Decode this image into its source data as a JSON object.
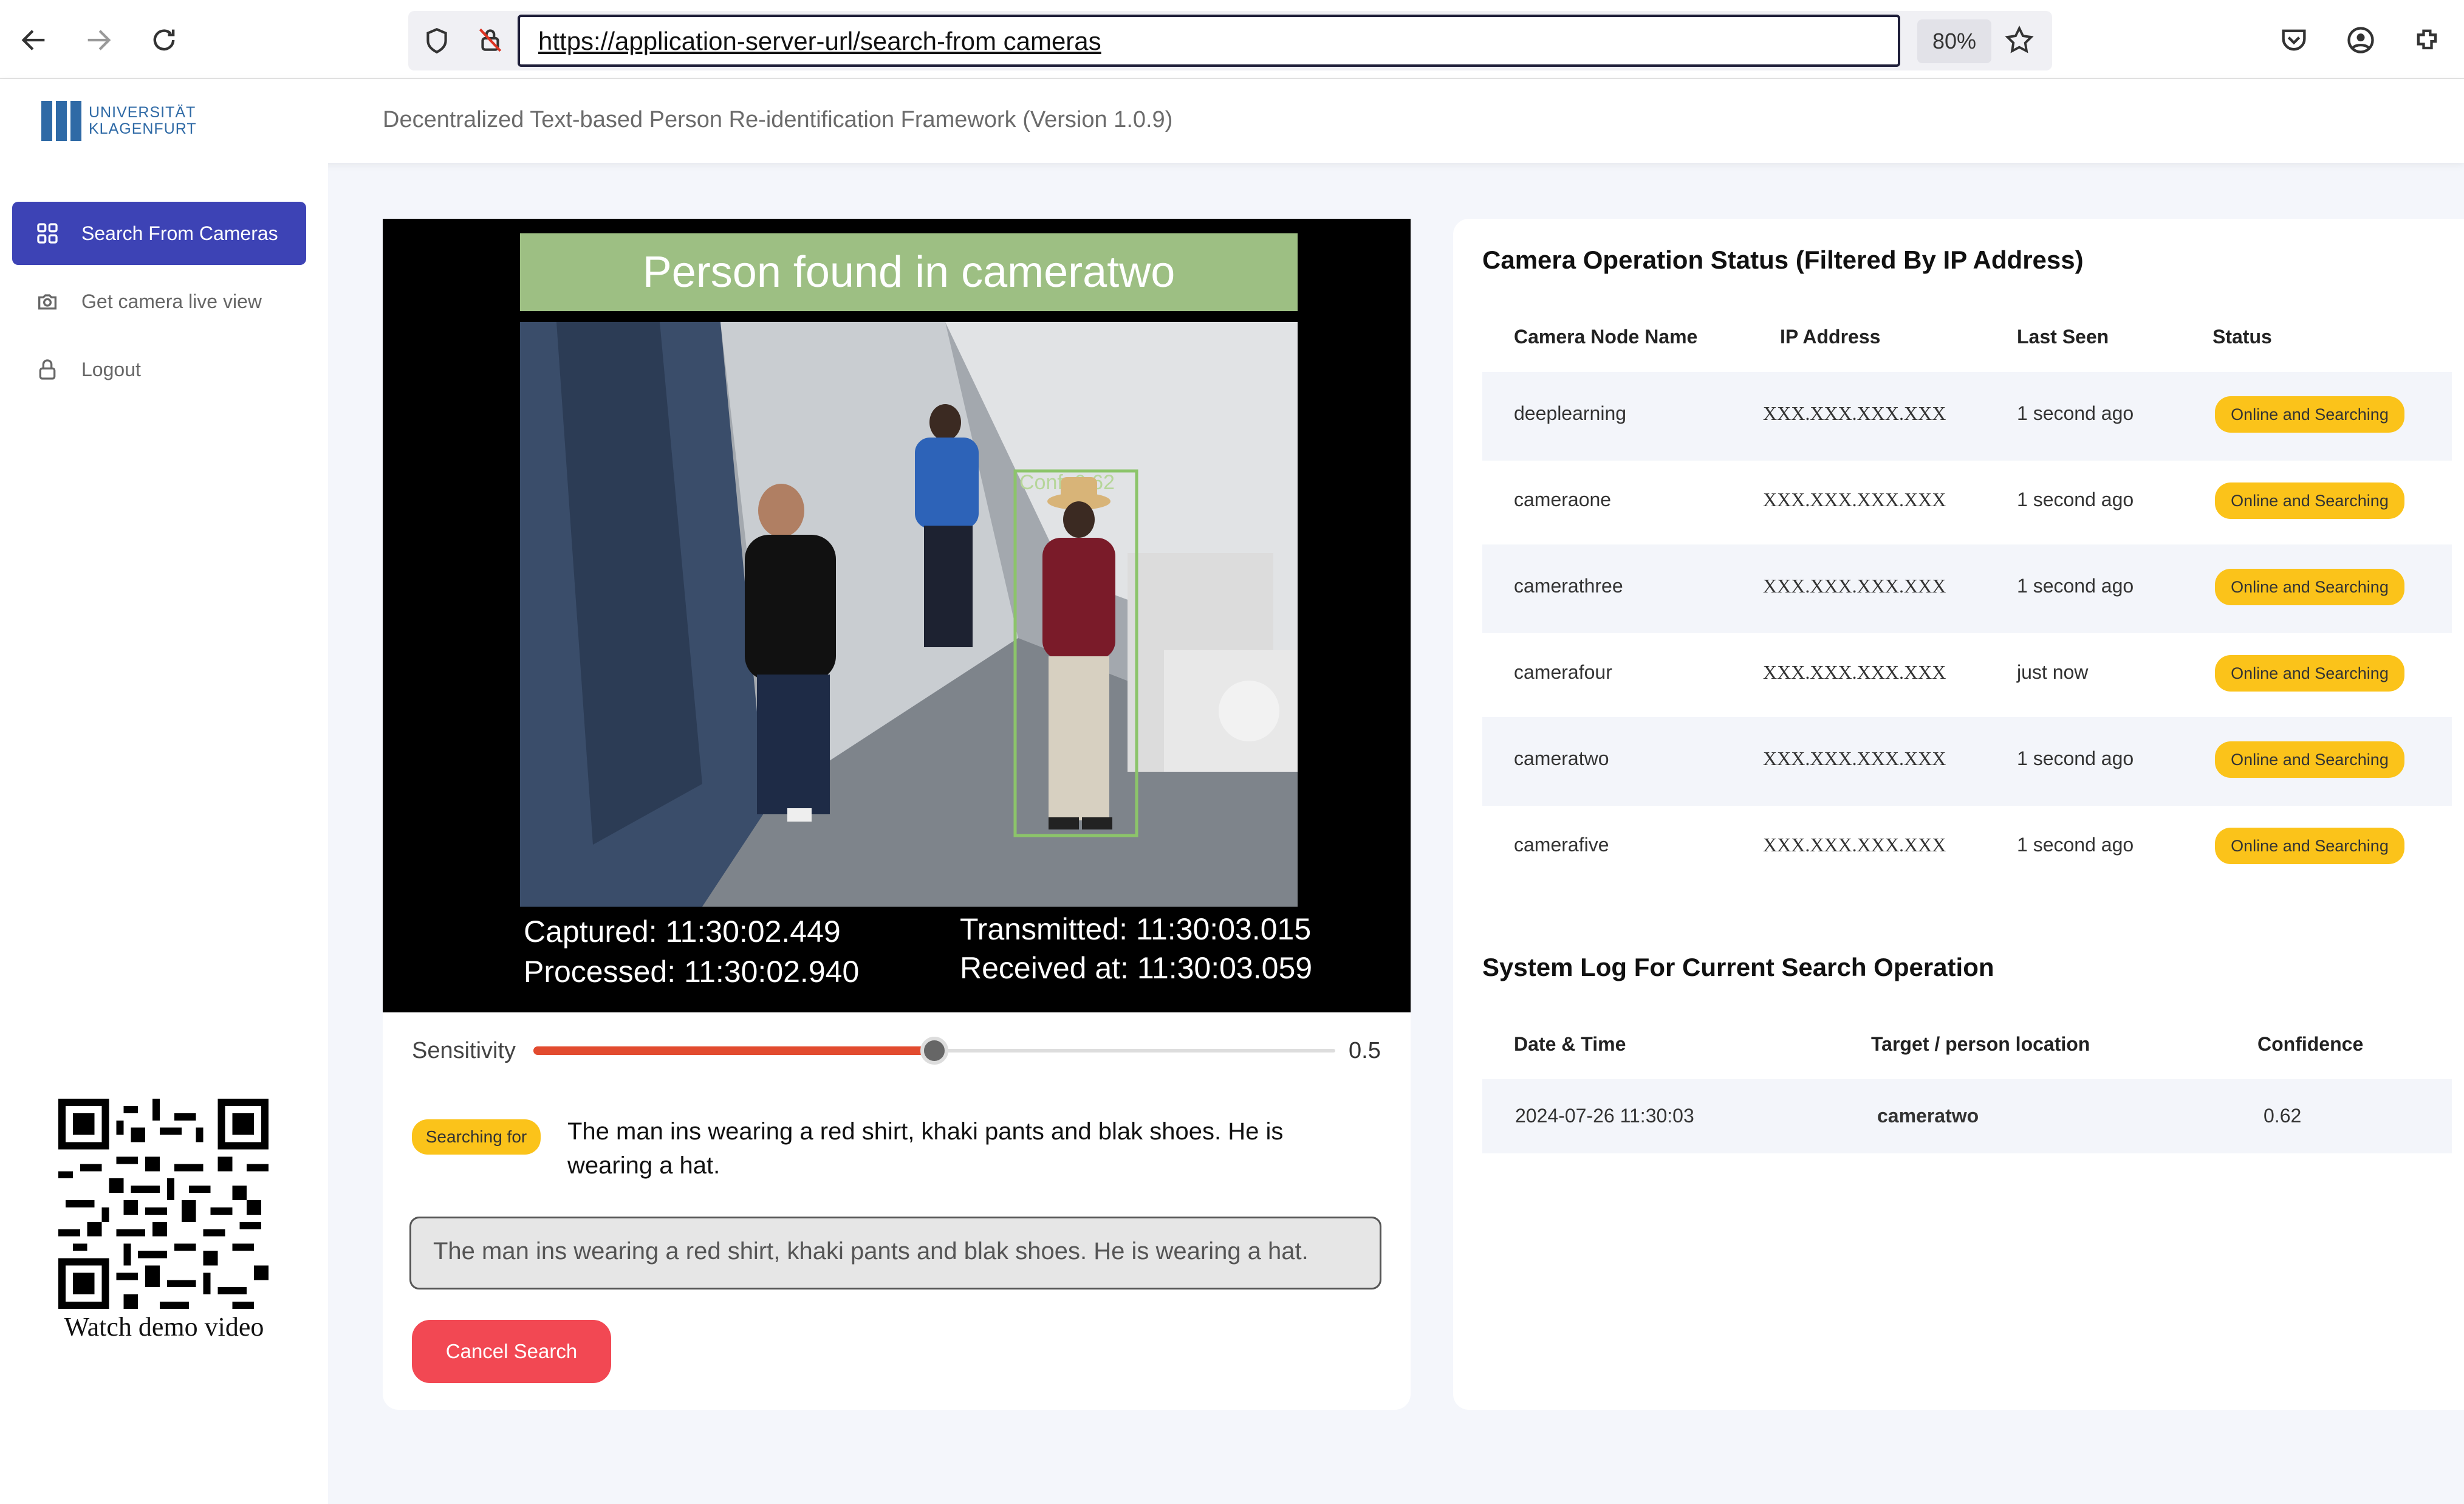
{
  "browser": {
    "url": "https://application-server-url/search-from cameras",
    "zoom": "80%"
  },
  "header": {
    "logo_line1": "UNIVERSITÄT",
    "logo_line2": "KLAGENFURT",
    "app_title": "Decentralized Text-based Person Re-identification Framework (Version 1.0.9)"
  },
  "sidebar": {
    "items": [
      {
        "label": "Search From Cameras",
        "icon": "grid-icon",
        "active": true
      },
      {
        "label": "Get camera live view",
        "icon": "camera-icon"
      },
      {
        "label": "Logout",
        "icon": "lock-icon"
      }
    ],
    "qr_caption": "Watch demo video"
  },
  "camera_view": {
    "banner": "Person found in cameratwo",
    "detection_label": "Conf: 0.62",
    "captured": "Captured:   11:30:02.449",
    "processed": "Processed: 11:30:02.940",
    "transmitted": "Transmitted: 11:30:03.015",
    "received": "Received at: 11:30:03.059"
  },
  "sensitivity": {
    "label": "Sensitivity",
    "value": 0.5,
    "value_text": "0.5"
  },
  "search": {
    "badge": "Searching for",
    "text": "The man ins wearing a red shirt, khaki pants and blak shoes. He is wearing a hat.",
    "input_value": "The man ins wearing a red shirt, khaki pants and blak shoes. He is wearing a hat.",
    "cancel_label": "Cancel Search"
  },
  "camera_status": {
    "title": "Camera Operation Status (Filtered By IP Address)",
    "headers": [
      "Camera Node Name",
      "IP Address",
      "Last Seen",
      "Status"
    ],
    "rows": [
      {
        "name": "deeplearning",
        "ip": "XXX.XXX.XXX.XXX",
        "last_seen": "1 second ago",
        "status": "Online and Searching"
      },
      {
        "name": "cameraone",
        "ip": "XXX.XXX.XXX.XXX",
        "last_seen": "1 second ago",
        "status": "Online and Searching"
      },
      {
        "name": "camerathree",
        "ip": "XXX.XXX.XXX.XXX",
        "last_seen": "1 second ago",
        "status": "Online and Searching"
      },
      {
        "name": "camerafour",
        "ip": "XXX.XXX.XXX.XXX",
        "last_seen": "just now",
        "status": "Online and Searching"
      },
      {
        "name": "cameratwo",
        "ip": "XXX.XXX.XXX.XXX",
        "last_seen": "1 second ago",
        "status": "Online and Searching"
      },
      {
        "name": "camerafive",
        "ip": "XXX.XXX.XXX.XXX",
        "last_seen": "1 second ago",
        "status": "Online and Searching"
      }
    ],
    "status_color": "#fbc31a"
  },
  "system_log": {
    "title": "System Log For Current Search Operation",
    "headers": [
      "Date & Time",
      "Target / person location",
      "Confidence"
    ],
    "rows": [
      {
        "datetime": "2024-07-26 11:30:03",
        "target": "cameratwo",
        "confidence": "0.62"
      }
    ]
  },
  "colors": {
    "accent": "#3d43b5",
    "cancel": "#f24853",
    "slider": "#e24b2f",
    "banner": "#9dbf83"
  }
}
